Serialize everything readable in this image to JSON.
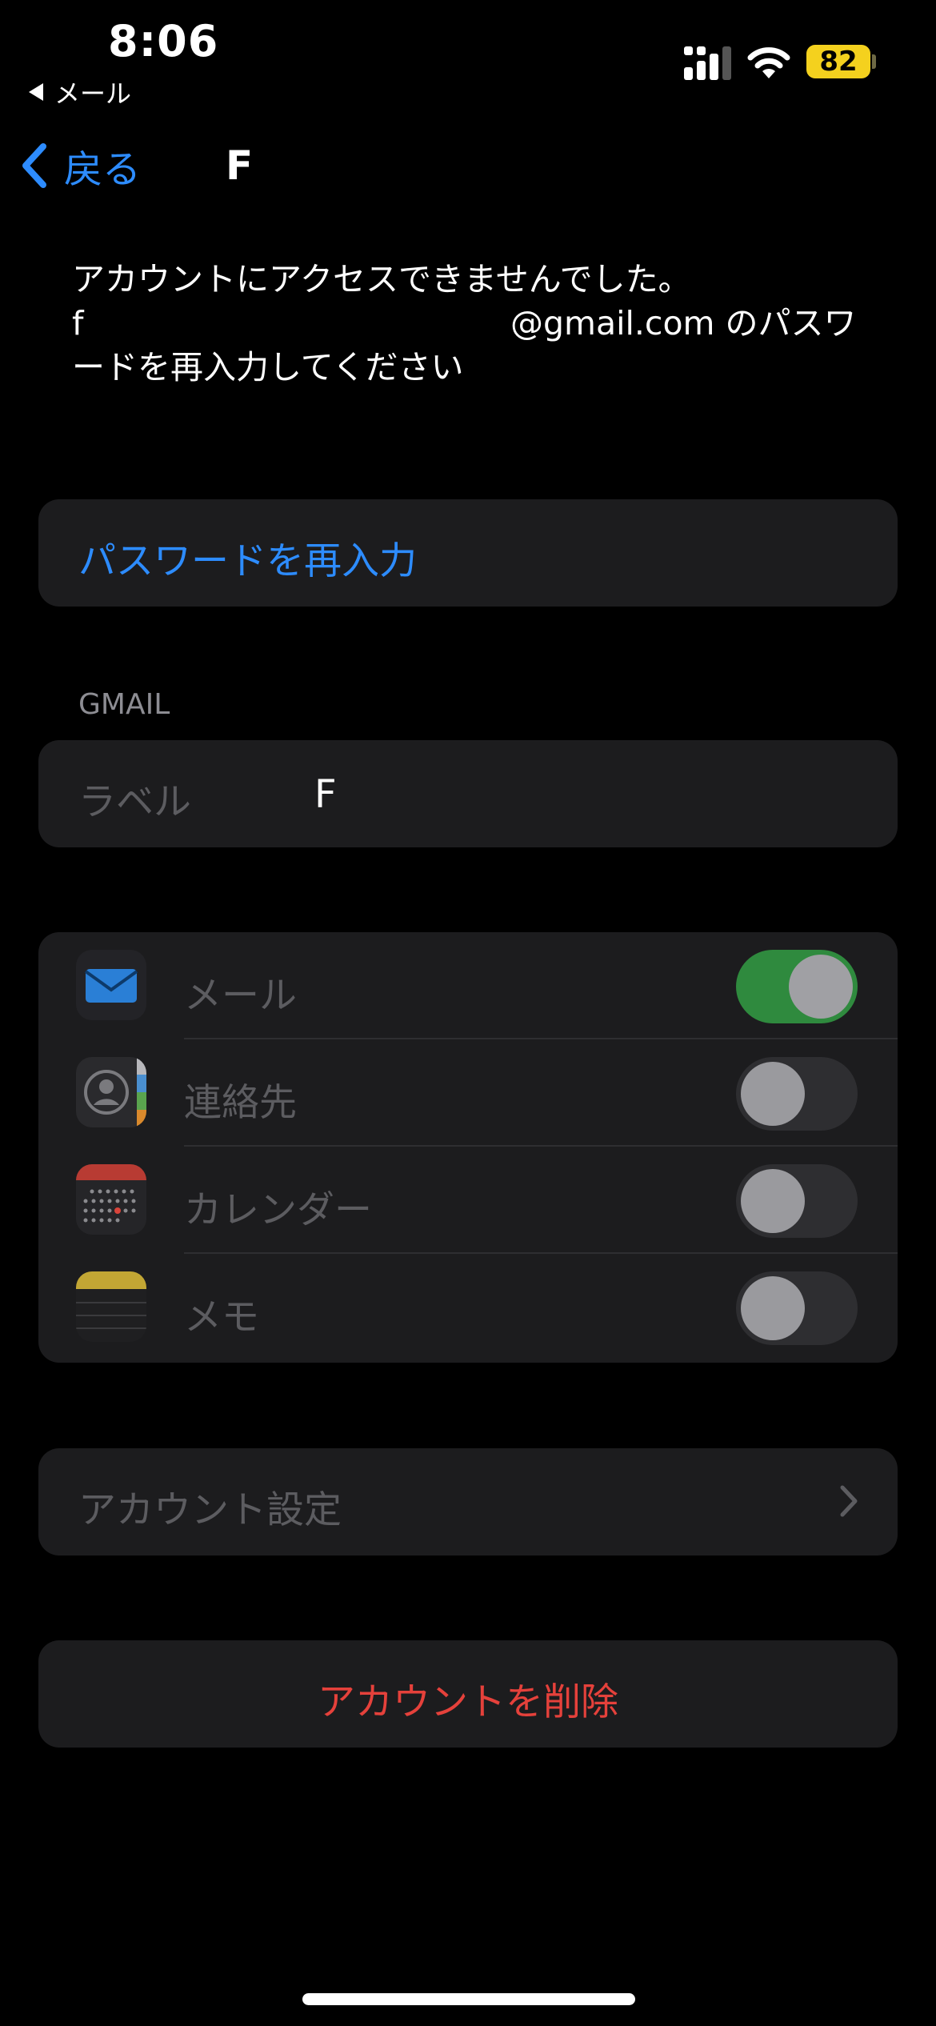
{
  "status_bar": {
    "time": "8:06",
    "back_app": "メール",
    "battery": "82"
  },
  "nav": {
    "back_label": "戻る",
    "title": "F"
  },
  "message": {
    "line1": "アカウントにアクセスできませんでした。",
    "email_start": "f",
    "email_end_and_text": "@gmail.com のパスワ",
    "line3": "ードを再入力してください"
  },
  "reenter_password": "パスワードを再入力",
  "gmail_section": {
    "header": "GMAIL",
    "label_key": "ラベル",
    "label_value": "F"
  },
  "services": [
    {
      "label": "メール",
      "icon": "mail-icon",
      "enabled": true
    },
    {
      "label": "連絡先",
      "icon": "contacts-icon",
      "enabled": false
    },
    {
      "label": "カレンダー",
      "icon": "calendar-icon",
      "enabled": false
    },
    {
      "label": "メモ",
      "icon": "notes-icon",
      "enabled": false
    }
  ],
  "account_settings": "アカウント設定",
  "delete_account": "アカウントを削除",
  "colors": {
    "accent": "#2d8cff",
    "destructive": "#e5413b",
    "toggle_on": "#2f8a3e",
    "card": "#1c1c1e"
  }
}
